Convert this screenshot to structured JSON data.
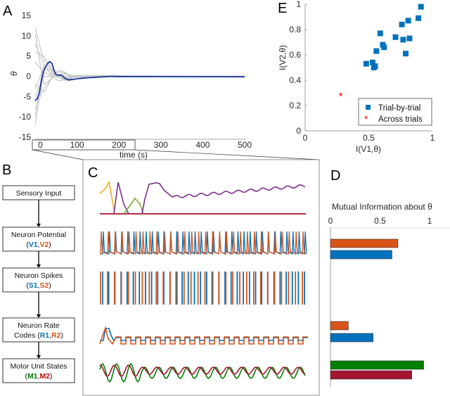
{
  "panels": {
    "A": "A",
    "B": "B",
    "C": "C",
    "D": "D",
    "E": "E"
  },
  "colors": {
    "gray_trials": "#c8c8c8",
    "blue_mean": "#1a33a0",
    "neuron1": "#0072bd",
    "neuron2": "#d95319",
    "motor1": "#008000",
    "motor2": "#a2142f",
    "sensory_yellow": "#edb120",
    "sensory_purple": "#7e2f8e",
    "sensory_green": "#77ac30",
    "star_red": "#ff0000",
    "scatter_blue": "#0072bd"
  },
  "chart_data": [
    {
      "id": "A",
      "type": "line",
      "title": "",
      "xlabel": "time (s)",
      "ylabel": "θ",
      "xlim": [
        0,
        500
      ],
      "ylim": [
        -15,
        15
      ],
      "xticks": [
        "0",
        "100",
        "200",
        "300",
        "400",
        "500"
      ],
      "yticks": [
        "15",
        "10",
        "5",
        "0",
        "-5",
        "-10",
        "-15"
      ],
      "zoom_window_s": [
        0,
        225
      ],
      "series": [
        {
          "name": "mean trial",
          "color": "#1a33a0",
          "x": [
            0,
            5,
            10,
            15,
            20,
            25,
            30,
            35,
            40,
            45,
            50,
            55,
            60,
            65,
            70,
            75,
            80,
            85,
            90,
            100,
            120,
            150,
            180,
            200,
            250,
            300,
            350,
            400,
            450,
            500
          ],
          "y": [
            -6,
            -5.5,
            -4,
            -1,
            1.2,
            2.4,
            3.2,
            3.6,
            3.2,
            1.5,
            0.4,
            0.3,
            0.3,
            0.2,
            -0.4,
            -0.7,
            -0.9,
            -0.8,
            -0.8,
            -0.6,
            -0.4,
            -0.2,
            0,
            0,
            0,
            0,
            0,
            0,
            0,
            0
          ]
        }
      ],
      "gray_trials_start_values": [
        12,
        10.5,
        8,
        6,
        3.5,
        -2,
        -3,
        -5,
        -8,
        -10,
        -12
      ]
    },
    {
      "id": "E",
      "type": "scatter",
      "xlabel": "I(V1,θ)",
      "ylabel": "I(V2,θ)",
      "xlim": [
        0,
        1
      ],
      "ylim": [
        0,
        1
      ],
      "xticks": [
        "0",
        "0.5",
        "1"
      ],
      "yticks": [
        "0",
        "0.2",
        "0.4",
        "0.6",
        "0.8",
        "1"
      ],
      "legend": [
        "Trial-by-trial",
        "Across trials"
      ],
      "legend_position": "bottom-right",
      "series": [
        {
          "name": "Trial-by-trial",
          "marker": "square",
          "color": "#0072bd",
          "points": [
            [
              0.48,
              0.53
            ],
            [
              0.53,
              0.54
            ],
            [
              0.54,
              0.5
            ],
            [
              0.55,
              0.51
            ],
            [
              0.56,
              0.63
            ],
            [
              0.59,
              0.77
            ],
            [
              0.61,
              0.68
            ],
            [
              0.62,
              0.66
            ],
            [
              0.71,
              0.74
            ],
            [
              0.76,
              0.84
            ],
            [
              0.77,
              0.72
            ],
            [
              0.81,
              0.87
            ],
            [
              0.82,
              0.73
            ],
            [
              0.79,
              0.61
            ],
            [
              0.89,
              0.89
            ],
            [
              0.91,
              0.98
            ]
          ]
        },
        {
          "name": "Across trials",
          "marker": "asterisk",
          "color": "#ff0000",
          "points": [
            [
              0.28,
              0.28
            ]
          ]
        }
      ]
    },
    {
      "id": "D",
      "type": "bar",
      "orientation": "horizontal",
      "title": "Mutual Information about θ",
      "xlim": [
        0,
        1.2
      ],
      "xticks": [
        "0",
        "0.5",
        "1"
      ],
      "bars": [
        {
          "name": "V2",
          "row": "Neuron Potential",
          "value": 0.68,
          "color": "#d95319"
        },
        {
          "name": "V1",
          "row": "Neuron Potential",
          "value": 0.62,
          "color": "#0072bd"
        },
        {
          "name": "R2",
          "row": "Neuron Rate Codes",
          "value": 0.18,
          "color": "#d95319"
        },
        {
          "name": "R1",
          "row": "Neuron Rate Codes",
          "value": 0.43,
          "color": "#0072bd"
        },
        {
          "name": "M1",
          "row": "Motor Unit States",
          "value": 0.94,
          "color": "#008000"
        },
        {
          "name": "M2",
          "row": "Motor Unit States",
          "value": 0.82,
          "color": "#a2142f"
        }
      ]
    }
  ],
  "flow": {
    "boxes": [
      {
        "line1": "Sensory Input",
        "line2": null
      },
      {
        "line1": "Neuron Potential",
        "line2": {
          "open": "(",
          "a": "V1",
          "sep": ",",
          "b": "V2",
          "close": ")",
          "a_color": "#0072bd",
          "b_color": "#d95319"
        }
      },
      {
        "line1": "Neuron Spikes",
        "line2": {
          "open": "(",
          "a": "S1",
          "sep": ",",
          "b": "S2",
          "close": ")",
          "a_color": "#0072bd",
          "b_color": "#d95319"
        }
      },
      {
        "line1": "Neuron Rate",
        "line2": {
          "open": "Codes (",
          "a": "R1",
          "sep": ",",
          "b": "R2",
          "close": ")",
          "a_color": "#0072bd",
          "b_color": "#d95319"
        }
      },
      {
        "line1": "Motor Unit States",
        "line2": {
          "open": "(",
          "a": "M1",
          "sep": ",",
          "b": "M2",
          "close": ")",
          "a_color": "#008000",
          "b_color": "#c00000"
        }
      }
    ]
  }
}
